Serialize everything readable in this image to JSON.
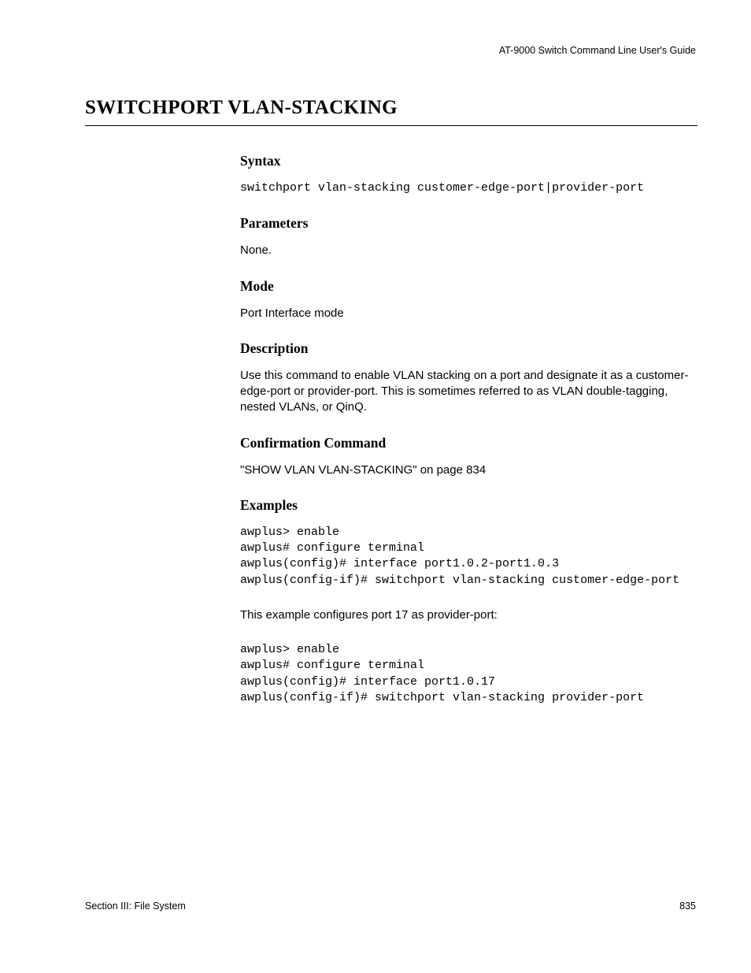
{
  "header": {
    "doc_title": "AT-9000 Switch Command Line User's Guide"
  },
  "title": "SWITCHPORT VLAN-STACKING",
  "sections": {
    "syntax": {
      "heading": "Syntax",
      "code": "switchport vlan-stacking customer-edge-port|provider-port"
    },
    "parameters": {
      "heading": "Parameters",
      "text": "None."
    },
    "mode": {
      "heading": "Mode",
      "text": "Port Interface mode"
    },
    "description": {
      "heading": "Description",
      "text": "Use this command to enable VLAN stacking on a port and designate it as a customer-edge-port or provider-port. This is sometimes referred to as VLAN double-tagging, nested VLANs, or QinQ."
    },
    "confirmation": {
      "heading": "Confirmation Command",
      "text": "\"SHOW VLAN VLAN-STACKING\" on page 834"
    },
    "examples": {
      "heading": "Examples",
      "code1": "awplus> enable\nawplus# configure terminal\nawplus(config)# interface port1.0.2-port1.0.3\nawplus(config-if)# switchport vlan-stacking customer-edge-port",
      "intro2": "This example configures port 17 as provider-port:",
      "code2": "awplus> enable\nawplus# configure terminal\nawplus(config)# interface port1.0.17\nawplus(config-if)# switchport vlan-stacking provider-port"
    }
  },
  "footer": {
    "section": "Section III: File System",
    "page": "835"
  }
}
